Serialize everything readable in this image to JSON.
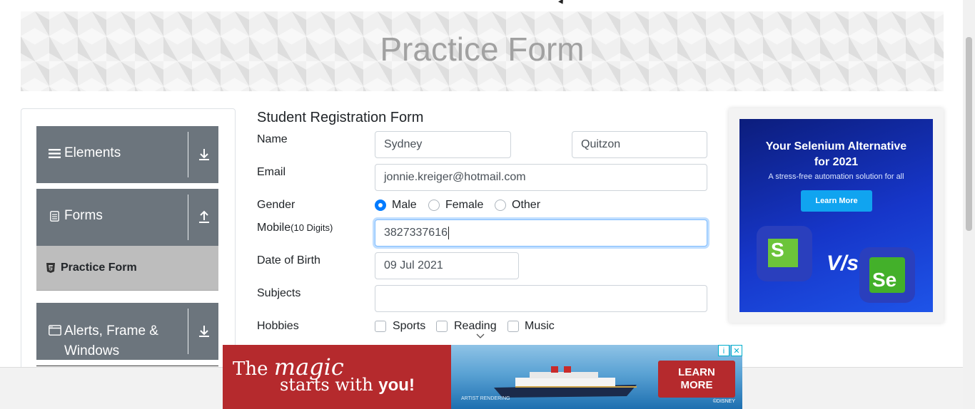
{
  "banner": {
    "title": "Practice Form"
  },
  "sidebar": {
    "groups": [
      {
        "label": "Elements",
        "icon": "hamburger-icon",
        "arrow": "download-arrow-icon"
      },
      {
        "label": "Forms",
        "icon": "document-icon",
        "arrow": "upload-arrow-icon"
      },
      {
        "label": "Alerts, Frame & Windows",
        "label_line1": "Alerts, Frame &",
        "label_line2": "Windows",
        "icon": "window-icon",
        "arrow": "download-arrow-icon"
      }
    ],
    "active_item": {
      "label": "Practice Form",
      "icon": "html5-icon"
    }
  },
  "form": {
    "title": "Student Registration Form",
    "name_label": "Name",
    "first_name": "Sydney",
    "last_name": "Quitzon",
    "email_label": "Email",
    "email": "jonnie.kreiger@hotmail.com",
    "gender_label": "Gender",
    "gender_options": [
      "Male",
      "Female",
      "Other"
    ],
    "gender_selected": "Male",
    "mobile_label": "Mobile",
    "mobile_hint": "(10 Digits)",
    "mobile": "3827337616",
    "dob_label": "Date of Birth",
    "dob": "09 Jul 2021",
    "subjects_label": "Subjects",
    "subjects": "",
    "hobbies_label": "Hobbies",
    "hobbies": [
      "Sports",
      "Reading",
      "Music"
    ]
  },
  "right_ad": {
    "title_line1": "Your Selenium Alternative",
    "title_line2": "for 2021",
    "subtitle": "A stress-free automation solution for all",
    "button": "Learn More",
    "vs": "V/s",
    "logo_left": "S",
    "logo_right": "Se"
  },
  "bottom_ad": {
    "line1_a": "The ",
    "line1_b": "magic",
    "line2_a": "starts with ",
    "line2_b": "you!",
    "cta_line1": "LEARN",
    "cta_line2": "MORE",
    "small_left": "ARTIST RENDERING",
    "small_right": "©DISNEY",
    "info_icon": "info-icon",
    "close_icon": "close-icon"
  },
  "colors": {
    "sidebar_group": "#6c757d",
    "sidebar_active": "#bdbdbd",
    "accent": "#007bff",
    "ad_red": "#b52a2d"
  }
}
